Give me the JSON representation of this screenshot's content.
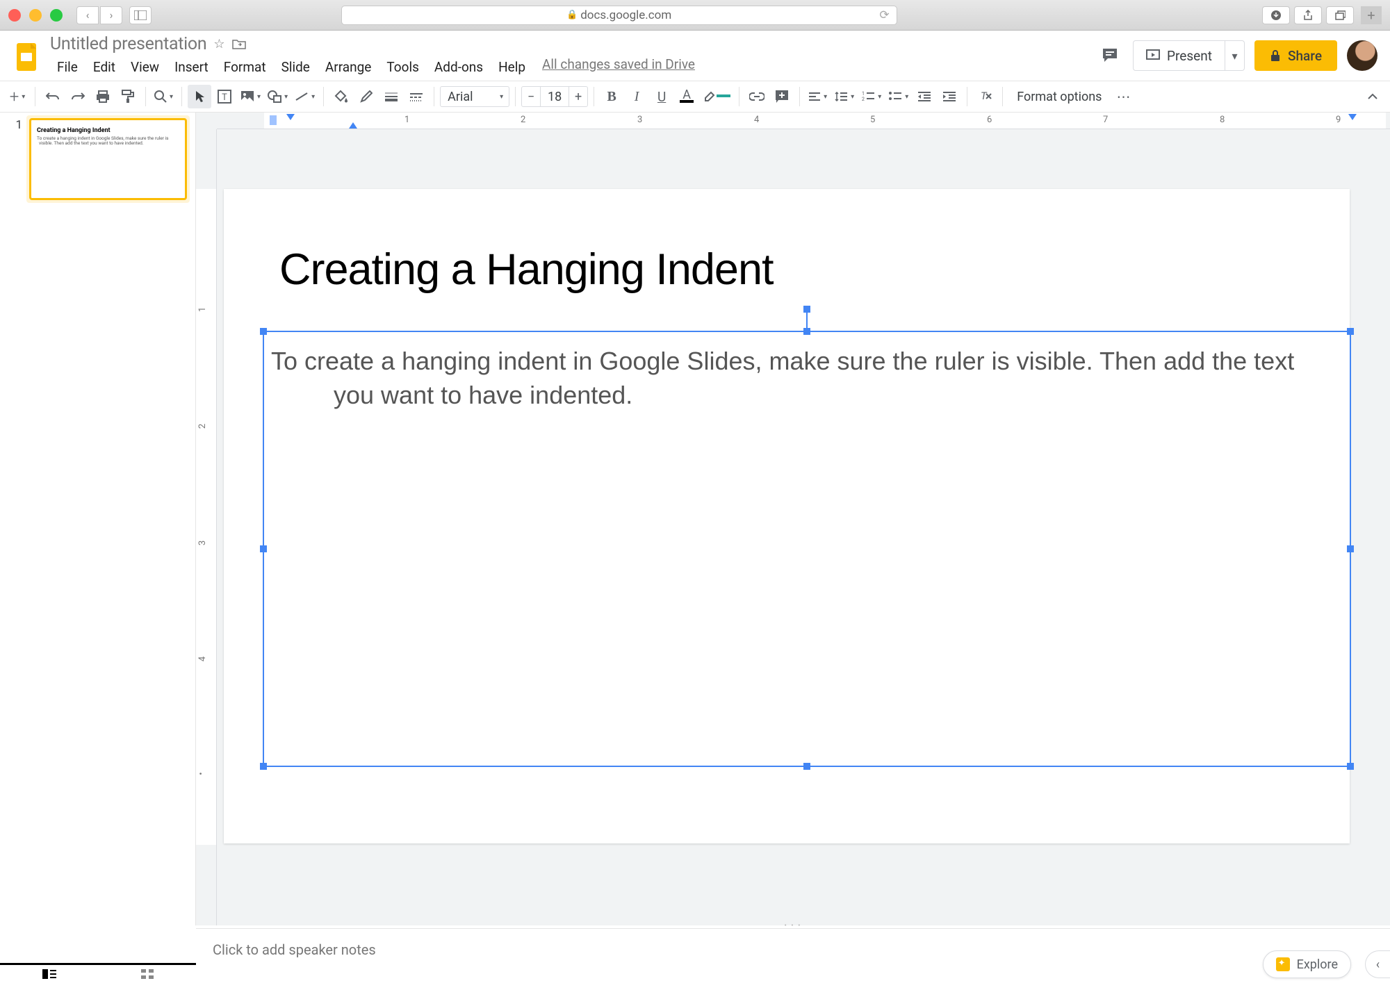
{
  "browser": {
    "url": "docs.google.com"
  },
  "doc": {
    "title": "Untitled presentation",
    "save_status": "All changes saved in Drive"
  },
  "menubar": [
    "File",
    "Edit",
    "View",
    "Insert",
    "Format",
    "Slide",
    "Arrange",
    "Tools",
    "Add-ons",
    "Help"
  ],
  "header": {
    "present": "Present",
    "share": "Share"
  },
  "toolbar": {
    "font": "Arial",
    "font_size": "18",
    "format_options": "Format options"
  },
  "ruler": {
    "h_ticks": [
      "1",
      "2",
      "3",
      "4",
      "5",
      "6",
      "7",
      "8",
      "9"
    ],
    "v_ticks": [
      "1",
      "2",
      "3",
      "4"
    ]
  },
  "filmstrip": {
    "slides": [
      {
        "num": "1",
        "title": "Creating a Hanging Indent",
        "body": "To create a hanging indent in Google Slides, make sure the ruler is visible. Then add the text you want to have indented."
      }
    ]
  },
  "slide": {
    "title": "Creating a Hanging Indent",
    "body": "To create a hanging indent in Google Slides, make sure the ruler is visible. Then add the text you want to have indented."
  },
  "notes": {
    "placeholder": "Click to add speaker notes"
  },
  "explore": {
    "label": "Explore"
  }
}
